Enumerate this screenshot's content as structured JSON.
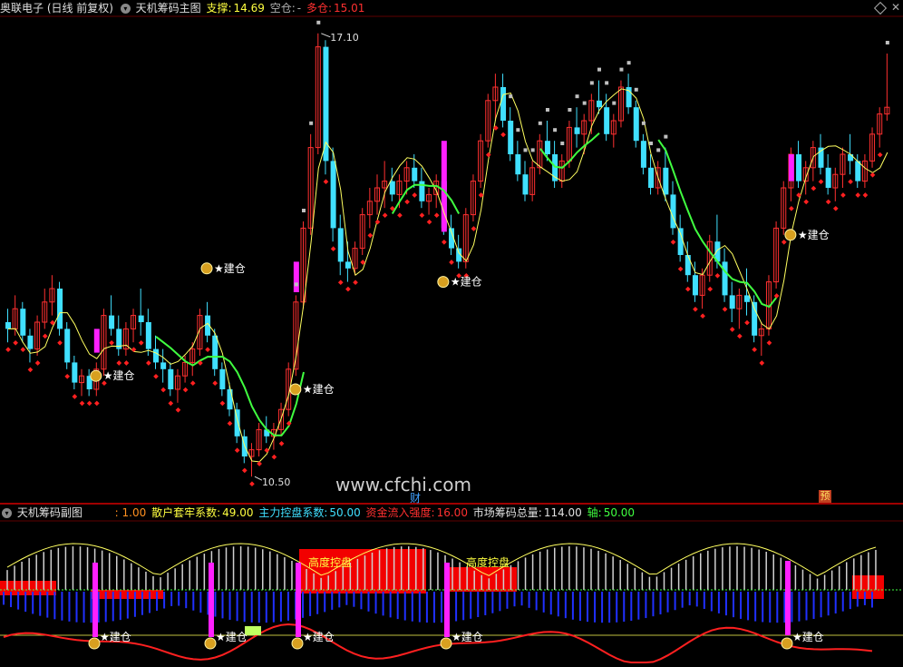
{
  "main_header": {
    "stock": "奥联电子 (日线 前复权)",
    "indicator": "天机筹码主图",
    "support_label": "支撑:",
    "support_value": "14.69",
    "empty_label": "空仓:",
    "empty_value": "-",
    "long_label": "多仓:",
    "long_value": "15.01"
  },
  "sub_header": {
    "indicator": "天机筹码副图",
    "first_value": ": 1.00",
    "retail_label": "散户套牢系数:",
    "retail_value": "49.00",
    "main_label": "主力控盘系数:",
    "main_value": "50.00",
    "flow_label": "资金流入强度:",
    "flow_value": "16.00",
    "total_label": "市场筹码总量:",
    "total_value": "114.00",
    "axis_label": "轴:",
    "axis_value": "50.00"
  },
  "annotations": {
    "high_price": "17.10",
    "low_price": "10.50",
    "build": "建仓",
    "control_1": "高度控盘",
    "control_2": "高度控盘",
    "watermark": "www.cfchi.com",
    "cai": "财",
    "yu": "预"
  },
  "colors": {
    "up": "#ff3030",
    "down": "#40e0ff",
    "signal_bar": "#ff20ff",
    "support_dots": "#ff2020",
    "resistance_dots": "#c0c0c0",
    "trend_line": "#40ff40",
    "thin_line": "#ffff60",
    "sub_red_fill": "#ff0000",
    "sub_blue": "#2030ff",
    "sub_red_line": "#ff2020"
  },
  "chart_data": {
    "type": "candlestick",
    "ylim": [
      10.3,
      17.3
    ],
    "marked_high": 17.1,
    "marked_low": 10.5,
    "candles": [
      [
        12.8,
        13.0,
        12.5,
        12.7
      ],
      [
        12.7,
        13.2,
        12.6,
        13.0
      ],
      [
        13.0,
        13.1,
        12.5,
        12.6
      ],
      [
        12.6,
        12.7,
        12.2,
        12.4
      ],
      [
        12.4,
        12.9,
        12.3,
        12.8
      ],
      [
        12.8,
        13.3,
        12.7,
        13.1
      ],
      [
        13.1,
        13.5,
        12.9,
        13.3
      ],
      [
        13.3,
        13.4,
        12.6,
        12.7
      ],
      [
        12.7,
        12.8,
        12.1,
        12.2
      ],
      [
        12.2,
        12.3,
        11.8,
        11.9
      ],
      [
        11.9,
        12.1,
        11.7,
        12.0
      ],
      [
        12.0,
        12.1,
        11.7,
        11.8
      ],
      [
        11.8,
        12.2,
        11.7,
        12.1
      ],
      [
        12.1,
        13.0,
        12.0,
        12.9
      ],
      [
        12.9,
        13.2,
        12.6,
        12.7
      ],
      [
        12.7,
        12.9,
        12.3,
        12.4
      ],
      [
        12.4,
        12.8,
        12.3,
        12.7
      ],
      [
        12.7,
        13.0,
        12.5,
        12.9
      ],
      [
        12.9,
        13.3,
        12.6,
        12.8
      ],
      [
        12.8,
        13.0,
        12.3,
        12.4
      ],
      [
        12.4,
        12.6,
        12.1,
        12.2
      ],
      [
        12.2,
        12.4,
        11.9,
        12.1
      ],
      [
        12.1,
        12.2,
        11.7,
        11.8
      ],
      [
        11.8,
        12.1,
        11.6,
        12.0
      ],
      [
        12.0,
        12.3,
        11.9,
        12.2
      ],
      [
        12.2,
        12.5,
        12.0,
        12.4
      ],
      [
        12.4,
        13.0,
        12.3,
        12.9
      ],
      [
        12.9,
        13.1,
        12.5,
        12.6
      ],
      [
        12.6,
        12.7,
        12.0,
        12.1
      ],
      [
        12.1,
        12.2,
        11.7,
        11.8
      ],
      [
        11.8,
        11.9,
        11.4,
        11.5
      ],
      [
        11.5,
        11.6,
        11.0,
        11.1
      ],
      [
        11.1,
        11.2,
        10.7,
        10.8
      ],
      [
        10.8,
        11.0,
        10.5,
        10.9
      ],
      [
        10.9,
        11.3,
        10.8,
        11.2
      ],
      [
        11.2,
        11.4,
        11.0,
        11.1
      ],
      [
        11.1,
        11.3,
        10.9,
        11.2
      ],
      [
        11.2,
        11.6,
        11.1,
        11.5
      ],
      [
        11.5,
        12.2,
        11.4,
        12.1
      ],
      [
        12.1,
        13.2,
        12.0,
        13.1
      ],
      [
        13.1,
        14.3,
        13.0,
        14.2
      ],
      [
        14.2,
        15.6,
        14.1,
        15.4
      ],
      [
        15.4,
        17.1,
        15.3,
        16.9
      ],
      [
        16.9,
        17.0,
        15.0,
        15.2
      ],
      [
        15.2,
        15.4,
        14.0,
        14.2
      ],
      [
        14.2,
        14.4,
        13.5,
        13.7
      ],
      [
        13.7,
        14.0,
        13.4,
        13.6
      ],
      [
        13.6,
        14.0,
        13.5,
        13.9
      ],
      [
        13.9,
        14.5,
        13.8,
        14.4
      ],
      [
        14.4,
        14.8,
        14.2,
        14.6
      ],
      [
        14.6,
        15.0,
        14.4,
        14.8
      ],
      [
        14.8,
        15.2,
        14.5,
        14.9
      ],
      [
        14.9,
        15.1,
        14.6,
        14.7
      ],
      [
        14.7,
        15.0,
        14.5,
        14.9
      ],
      [
        14.9,
        15.2,
        14.7,
        15.1
      ],
      [
        15.1,
        15.3,
        14.8,
        14.9
      ],
      [
        14.9,
        15.1,
        14.5,
        14.6
      ],
      [
        14.6,
        14.8,
        14.4,
        14.7
      ],
      [
        14.7,
        15.0,
        14.5,
        14.9
      ],
      [
        14.9,
        15.1,
        14.1,
        14.2
      ],
      [
        14.2,
        14.4,
        13.8,
        13.9
      ],
      [
        13.9,
        14.1,
        13.6,
        13.7
      ],
      [
        13.7,
        14.5,
        13.6,
        14.4
      ],
      [
        14.4,
        15.0,
        14.3,
        14.9
      ],
      [
        14.9,
        15.6,
        14.8,
        15.5
      ],
      [
        15.5,
        16.2,
        15.4,
        16.1
      ],
      [
        16.1,
        16.5,
        15.8,
        16.3
      ],
      [
        16.3,
        16.5,
        15.7,
        15.8
      ],
      [
        15.8,
        16.0,
        15.2,
        15.3
      ],
      [
        15.3,
        15.5,
        14.9,
        15.0
      ],
      [
        15.0,
        15.2,
        14.6,
        14.7
      ],
      [
        14.7,
        15.2,
        14.6,
        15.1
      ],
      [
        15.1,
        15.6,
        15.0,
        15.5
      ],
      [
        15.5,
        15.8,
        15.2,
        15.3
      ],
      [
        15.3,
        15.5,
        14.8,
        14.9
      ],
      [
        14.9,
        15.3,
        14.8,
        15.2
      ],
      [
        15.2,
        15.8,
        15.1,
        15.7
      ],
      [
        15.7,
        16.0,
        15.4,
        15.6
      ],
      [
        15.6,
        15.9,
        15.3,
        15.8
      ],
      [
        15.8,
        16.2,
        15.6,
        16.1
      ],
      [
        16.1,
        16.4,
        15.9,
        16.0
      ],
      [
        16.0,
        16.2,
        15.5,
        15.6
      ],
      [
        15.6,
        15.9,
        15.4,
        15.8
      ],
      [
        15.8,
        16.4,
        15.7,
        16.3
      ],
      [
        16.3,
        16.5,
        15.9,
        16.0
      ],
      [
        16.0,
        16.1,
        15.4,
        15.5
      ],
      [
        15.5,
        15.6,
        15.0,
        15.1
      ],
      [
        15.1,
        15.3,
        14.7,
        14.8
      ],
      [
        14.8,
        15.2,
        14.7,
        15.1
      ],
      [
        15.1,
        15.4,
        14.6,
        14.7
      ],
      [
        14.7,
        14.9,
        14.1,
        14.2
      ],
      [
        14.2,
        14.4,
        13.7,
        13.8
      ],
      [
        13.8,
        14.0,
        13.4,
        13.5
      ],
      [
        13.5,
        13.7,
        13.1,
        13.2
      ],
      [
        13.2,
        13.6,
        13.0,
        13.5
      ],
      [
        13.5,
        14.1,
        13.4,
        14.0
      ],
      [
        14.0,
        14.4,
        13.6,
        13.7
      ],
      [
        13.7,
        13.9,
        13.1,
        13.2
      ],
      [
        13.2,
        13.4,
        12.8,
        13.0
      ],
      [
        13.0,
        13.3,
        12.7,
        13.2
      ],
      [
        13.2,
        13.6,
        12.9,
        13.1
      ],
      [
        13.1,
        13.2,
        12.5,
        12.6
      ],
      [
        12.6,
        12.8,
        12.3,
        12.7
      ],
      [
        12.7,
        13.5,
        12.6,
        13.4
      ],
      [
        13.4,
        14.3,
        13.3,
        14.2
      ],
      [
        14.2,
        14.9,
        14.1,
        14.8
      ],
      [
        14.8,
        15.4,
        14.6,
        15.3
      ],
      [
        15.3,
        15.5,
        14.8,
        14.9
      ],
      [
        14.9,
        15.2,
        14.7,
        15.1
      ],
      [
        15.1,
        15.5,
        14.9,
        15.4
      ],
      [
        15.4,
        15.6,
        15.0,
        15.1
      ],
      [
        15.1,
        15.3,
        14.7,
        14.8
      ],
      [
        14.8,
        15.1,
        14.6,
        15.0
      ],
      [
        15.0,
        15.4,
        14.8,
        15.3
      ],
      [
        15.3,
        15.6,
        15.0,
        15.2
      ],
      [
        15.2,
        15.3,
        14.8,
        14.9
      ],
      [
        14.9,
        15.3,
        14.8,
        15.2
      ],
      [
        15.2,
        15.7,
        15.1,
        15.6
      ],
      [
        15.6,
        16.0,
        15.4,
        15.9
      ],
      [
        15.9,
        16.8,
        15.8,
        16.0
      ]
    ]
  }
}
